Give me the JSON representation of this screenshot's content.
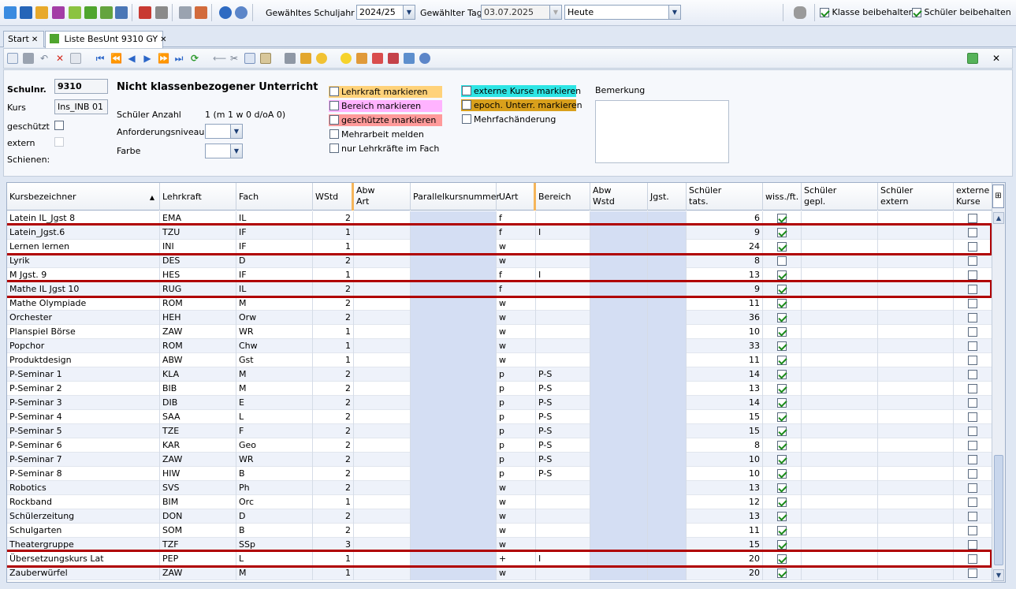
{
  "topbar": {
    "schuljahr_label": "Gewähltes Schuljahr",
    "schuljahr_value": "2024/25",
    "tag_label": "Gewählter Tag",
    "tag_value": "03.07.2025",
    "heute_value": "Heute",
    "klasse_beibehalten": "Klasse beibehalten",
    "schueler_beibehalten": "Schüler beibehalten"
  },
  "tabs": [
    {
      "label": "Start"
    },
    {
      "label": "Liste BesUnt 9310 GY"
    }
  ],
  "form": {
    "schulnr_label": "Schulnr.",
    "schulnr_value": "9310",
    "title": "Nicht klassenbezogener Unterricht",
    "kurs_label": "Kurs",
    "kurs_value": "Ins_INB 01",
    "geschuetzt_label": "geschützt",
    "extern_label": "extern",
    "schienen_label": "Schienen:",
    "anzahl_label": "Schüler Anzahl",
    "anzahl_value": "1 (m 1 w 0 d/oA 0)",
    "niveau_label": "Anforderungsniveau",
    "farbe_label": "Farbe",
    "marks": {
      "lehrkraft": "Lehrkraft markieren",
      "bereich": "Bereich markieren",
      "geschuetzte": "geschützte markieren",
      "mehrarbeit": "Mehrarbeit melden",
      "nur_lehrkraefte": "nur Lehrkräfte im Fach",
      "externe": "externe Kurse markieren",
      "epoch": "epoch. Unterr. markieren",
      "mehrfach": "Mehrfachänderung"
    },
    "bemerkung_label": "Bemerkung"
  },
  "grid": {
    "headers": {
      "kurs": "Kursbezeichner",
      "lehrkraft": "Lehrkraft",
      "fach": "Fach",
      "wstd": "WStd",
      "abw_art_1": "Abw",
      "abw_art_2": "Art",
      "parallel": "Parallelkursnummer",
      "uart": "UArt",
      "bereich": "Bereich",
      "abw_wstd_1": "Abw",
      "abw_wstd_2": "Wstd",
      "jgst": "Jgst.",
      "tats_1": "Schüler",
      "tats_2": "tats.",
      "wiss": "wiss./ft.",
      "gepl_1": "Schüler",
      "gepl_2": "gepl.",
      "ext_1": "Schüler",
      "ext_2": "extern",
      "extk_1": "externe",
      "extk_2": "Kurse"
    },
    "rows": [
      {
        "kurs": "Latein IL_Jgst 8",
        "lk": "EMA",
        "fach": "IL",
        "wstd": "2",
        "uart": "f",
        "bereich": "",
        "tats": "6",
        "wiss": true,
        "hl": false
      },
      {
        "kurs": "Latein_Jgst.6",
        "lk": "TZU",
        "fach": "IF",
        "wstd": "1",
        "uart": "f",
        "bereich": "I",
        "tats": "9",
        "wiss": true,
        "hl": true
      },
      {
        "kurs": "Lernen lernen",
        "lk": "INI",
        "fach": "IF",
        "wstd": "1",
        "uart": "w",
        "bereich": "",
        "tats": "24",
        "wiss": true,
        "hl": true
      },
      {
        "kurs": "Lyrik",
        "lk": "DES",
        "fach": "D",
        "wstd": "2",
        "uart": "w",
        "bereich": "",
        "tats": "8",
        "wiss": false,
        "hl": false
      },
      {
        "kurs": "M Jgst. 9",
        "lk": "HES",
        "fach": "IF",
        "wstd": "1",
        "uart": "f",
        "bereich": "I",
        "tats": "13",
        "wiss": true,
        "hl": false
      },
      {
        "kurs": "Mathe IL Jgst 10",
        "lk": "RUG",
        "fach": "IL",
        "wstd": "2",
        "uart": "f",
        "bereich": "",
        "tats": "9",
        "wiss": true,
        "hl": true
      },
      {
        "kurs": "Mathe Olympiade",
        "lk": "ROM",
        "fach": "M",
        "wstd": "2",
        "uart": "w",
        "bereich": "",
        "tats": "11",
        "wiss": true,
        "hl": false
      },
      {
        "kurs": "Orchester",
        "lk": "HEH",
        "fach": "Orw",
        "wstd": "2",
        "uart": "w",
        "bereich": "",
        "tats": "36",
        "wiss": true,
        "hl": false
      },
      {
        "kurs": "Planspiel Börse",
        "lk": "ZAW",
        "fach": "WR",
        "wstd": "1",
        "uart": "w",
        "bereich": "",
        "tats": "10",
        "wiss": true,
        "hl": false
      },
      {
        "kurs": "Popchor",
        "lk": "ROM",
        "fach": "Chw",
        "wstd": "1",
        "uart": "w",
        "bereich": "",
        "tats": "33",
        "wiss": true,
        "hl": false
      },
      {
        "kurs": "Produktdesign",
        "lk": "ABW",
        "fach": "Gst",
        "wstd": "1",
        "uart": "w",
        "bereich": "",
        "tats": "11",
        "wiss": true,
        "hl": false
      },
      {
        "kurs": "P-Seminar 1",
        "lk": "KLA",
        "fach": "M",
        "wstd": "2",
        "uart": "p",
        "bereich": "P-S",
        "tats": "14",
        "wiss": true,
        "hl": false
      },
      {
        "kurs": "P-Seminar 2",
        "lk": "BIB",
        "fach": "M",
        "wstd": "2",
        "uart": "p",
        "bereich": "P-S",
        "tats": "13",
        "wiss": true,
        "hl": false
      },
      {
        "kurs": "P-Seminar 3",
        "lk": "DIB",
        "fach": "E",
        "wstd": "2",
        "uart": "p",
        "bereich": "P-S",
        "tats": "14",
        "wiss": true,
        "hl": false
      },
      {
        "kurs": "P-Seminar 4",
        "lk": "SAA",
        "fach": "L",
        "wstd": "2",
        "uart": "p",
        "bereich": "P-S",
        "tats": "15",
        "wiss": true,
        "hl": false
      },
      {
        "kurs": "P-Seminar 5",
        "lk": "TZE",
        "fach": "F",
        "wstd": "2",
        "uart": "p",
        "bereich": "P-S",
        "tats": "15",
        "wiss": true,
        "hl": false
      },
      {
        "kurs": "P-Seminar 6",
        "lk": "KAR",
        "fach": "Geo",
        "wstd": "2",
        "uart": "p",
        "bereich": "P-S",
        "tats": "8",
        "wiss": true,
        "hl": false
      },
      {
        "kurs": "P-Seminar 7",
        "lk": "ZAW",
        "fach": "WR",
        "wstd": "2",
        "uart": "p",
        "bereich": "P-S",
        "tats": "10",
        "wiss": true,
        "hl": false
      },
      {
        "kurs": "P-Seminar 8",
        "lk": "HIW",
        "fach": "B",
        "wstd": "2",
        "uart": "p",
        "bereich": "P-S",
        "tats": "10",
        "wiss": true,
        "hl": false
      },
      {
        "kurs": "Robotics",
        "lk": "SVS",
        "fach": "Ph",
        "wstd": "2",
        "uart": "w",
        "bereich": "",
        "tats": "13",
        "wiss": true,
        "hl": false
      },
      {
        "kurs": "Rockband",
        "lk": "BIM",
        "fach": "Orc",
        "wstd": "1",
        "uart": "w",
        "bereich": "",
        "tats": "12",
        "wiss": true,
        "hl": false
      },
      {
        "kurs": "Schülerzeitung",
        "lk": "DON",
        "fach": "D",
        "wstd": "2",
        "uart": "w",
        "bereich": "",
        "tats": "13",
        "wiss": true,
        "hl": false
      },
      {
        "kurs": "Schulgarten",
        "lk": "SOM",
        "fach": "B",
        "wstd": "2",
        "uart": "w",
        "bereich": "",
        "tats": "11",
        "wiss": true,
        "hl": false
      },
      {
        "kurs": "Theatergruppe",
        "lk": "TZF",
        "fach": "SSp",
        "wstd": "3",
        "uart": "w",
        "bereich": "",
        "tats": "15",
        "wiss": true,
        "hl": false
      },
      {
        "kurs": "Übersetzungskurs Lat",
        "lk": "PEP",
        "fach": "L",
        "wstd": "1",
        "uart": "+",
        "bereich": "I",
        "tats": "20",
        "wiss": true,
        "hl": true
      },
      {
        "kurs": "Zauberwürfel",
        "lk": "ZAW",
        "fach": "M",
        "wstd": "1",
        "uart": "w",
        "bereich": "",
        "tats": "20",
        "wiss": true,
        "hl": false
      }
    ]
  },
  "colors": {
    "lehrkraft_mark": "#ffd27a",
    "bereich_mark": "#ffb3ff",
    "geschuetzte_mark": "#ff9a9a",
    "externe_mark": "#2ee5e5",
    "epoch_mark": "#d9a01c",
    "highlight": "#b00000"
  },
  "icons": [
    "app-icon-bar",
    "save-icon",
    "undo-icon",
    "delete-icon",
    "first-icon",
    "prev-page-icon",
    "prev-icon",
    "next-icon",
    "next-page-icon",
    "last-icon",
    "refresh-icon",
    "print-icon",
    "settings-icon",
    "help-icon",
    "close-icon"
  ]
}
